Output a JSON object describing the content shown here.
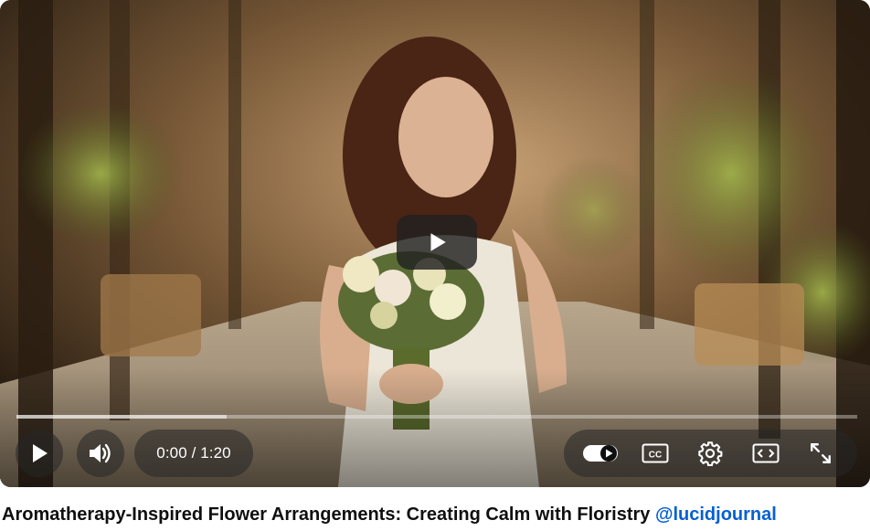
{
  "player": {
    "time_display": "0:00 / 1:20",
    "progress_fraction": 0.25,
    "autoplay_on": true
  },
  "icons": {
    "big_play": "play-icon",
    "play": "play-icon",
    "volume": "volume-icon",
    "autoplay": "autoplay-toggle-icon",
    "captions": "closed-captions-icon",
    "settings": "gear-icon",
    "theater": "theater-mode-icon",
    "fullscreen": "fullscreen-icon"
  },
  "captions_icon_text": "CC",
  "video": {
    "title": "Aromatherapy-Inspired Flower Arrangements: Creating Calm with Floristry",
    "channel": "@lucidjournal"
  },
  "colors": {
    "link": "#065fd4",
    "control_bg": "rgba(38,38,38,0.55)"
  }
}
